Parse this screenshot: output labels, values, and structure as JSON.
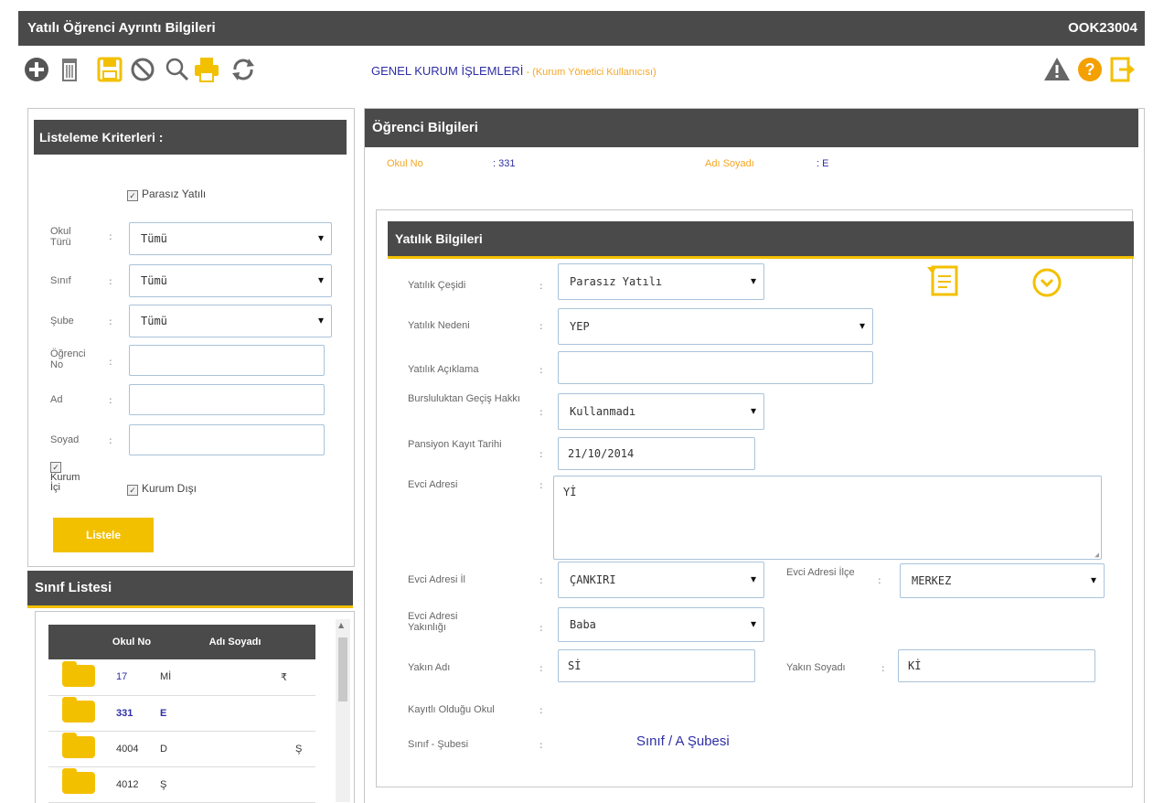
{
  "window": {
    "title": "Yatılı Öğrenci Ayrıntı Bilgileri",
    "code": "OOK23004"
  },
  "toolbar": {
    "crumb_main": "GENEL KURUM İŞLEMLERİ",
    "crumb_sub": " - (Kurum Yönetici Kullanıcısı)",
    "icons": [
      "add-icon",
      "delete-icon",
      "save-icon",
      "cancel-icon",
      "search-icon",
      "print-icon",
      "refresh-icon",
      "warning-icon",
      "help-icon",
      "exit-icon"
    ]
  },
  "left_panel": {
    "title": "Listeleme Kriterleri :",
    "checkbox_parasiz": "Parasız Yatılı",
    "fields": {
      "okul_turu": {
        "label": "Okul Türü",
        "value": "Tümü"
      },
      "sinif": {
        "label": "Sınıf",
        "value": "Tümü"
      },
      "sube": {
        "label": "Şube",
        "value": "Tümü"
      },
      "ogrenci_no": {
        "label": "Öğrenci No",
        "value": ""
      },
      "ad": {
        "label": "Ad",
        "value": ""
      },
      "soyad": {
        "label": "Soyad",
        "value": ""
      }
    },
    "checkbox_kurum_ici": "Kurum İçi",
    "checkbox_kurum_disi": "Kurum Dışı",
    "list_button": "Listele"
  },
  "class_list": {
    "title": "Sınıf Listesi",
    "headers": [
      "",
      "Okul No",
      "Adı Soyadı"
    ],
    "rows": [
      {
        "no": "17",
        "name": "Mİ",
        "extra": "₹"
      },
      {
        "no": "331",
        "name": "E",
        "extra": ""
      },
      {
        "no": "4004",
        "name": "D",
        "extra": "Ş"
      },
      {
        "no": "4012",
        "name": "Ş",
        "extra": ""
      }
    ]
  },
  "student": {
    "title": "Öğrenci Bilgileri",
    "okul_no_label": "Okul No",
    "okul_no_value": ": 331",
    "adi_soyadi_label": "Adı Soyadı",
    "adi_soyadi_value": ": E"
  },
  "yatilik": {
    "title": "Yatılık Bilgileri",
    "cesidi": {
      "label": "Yatılık Çeşidi",
      "value": "Parasız Yatılı"
    },
    "nedeni": {
      "label": "Yatılık Nedeni",
      "value": "YEP"
    },
    "aciklama": {
      "label": "Yatılık Açıklama",
      "value": ""
    },
    "bursluluk": {
      "label": "Bursluluktan Geçiş Hakkı",
      "value": "Kullanmadı"
    },
    "pansiyon": {
      "label": "Pansiyon Kayıt Tarihi",
      "value": "21/10/2014"
    },
    "evci_adresi": {
      "label": "Evci Adresi",
      "value": "Yİ"
    },
    "evci_il": {
      "label": "Evci Adresi İl",
      "value": "ÇANKIRI"
    },
    "evci_ilce": {
      "label": "Evci Adresi İlçe",
      "value": "MERKEZ"
    },
    "yakinligi": {
      "label": "Evci Adresi Yakınlığı",
      "value": "Baba"
    },
    "yakin_adi": {
      "label": "Yakın Adı",
      "value": "Sİ"
    },
    "yakin_soyadi": {
      "label": "Yakın Soyadı",
      "value": "Kİ"
    },
    "kayitli_okul": {
      "label": "Kayıtlı Olduğu Okul",
      "value": ""
    },
    "sinif_sube": {
      "label": "Sınıf - Şubesi",
      "value": "Sınıf / A Şubesi"
    }
  }
}
